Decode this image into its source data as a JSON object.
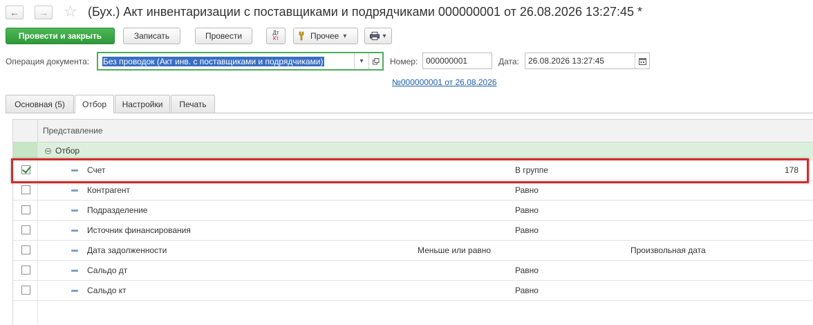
{
  "window": {
    "title": "(Бух.) Акт инвентаризации с поставщиками и подрядчиками 000000001 от 26.08.2026 13:27:45 *",
    "back_icon": "←",
    "forward_icon": "→",
    "star_icon": "☆"
  },
  "toolbar": {
    "post_close_label": "Провести и закрыть",
    "save_label": "Записать",
    "post_label": "Провести",
    "dtkt_top": "Дт",
    "dtkt_bottom": "Кт",
    "more_label": "Прочее",
    "dropdown_arrow": "▾"
  },
  "form": {
    "operation_label": "Операция документа:",
    "operation_value": "Без проводок (Акт инв. с поставщиками и подрядчиками)",
    "number_label": "Номер:",
    "number_value": "000000001",
    "date_label": "Дата:",
    "date_value": "26.08.2026 13:27:45",
    "doc_link": "№000000001 от 26.08.2026"
  },
  "tabs": [
    {
      "label": "Основная (5)"
    },
    {
      "label": "Отбор"
    },
    {
      "label": "Настройки"
    },
    {
      "label": "Печать"
    }
  ],
  "table": {
    "header": "Представление",
    "group_label": "Отбор",
    "rows": [
      {
        "name": "Счет",
        "condition": "В группе",
        "value": "178",
        "checked": true
      },
      {
        "name": "Контрагент",
        "condition": "Равно",
        "value": "",
        "checked": false
      },
      {
        "name": "Подразделение",
        "condition": "Равно",
        "value": "",
        "checked": false
      },
      {
        "name": "Источник финансирования",
        "condition": "Равно",
        "value": "",
        "checked": false
      },
      {
        "name": "Дата задолженности",
        "condition": "Меньше или равно",
        "value": "Произвольная дата",
        "checked": false
      },
      {
        "name": "Сальдо дт",
        "condition": "Равно",
        "value": "",
        "checked": false
      },
      {
        "name": "Сальдо кт",
        "condition": "Равно",
        "value": "",
        "checked": false
      }
    ]
  },
  "colors": {
    "accent_green": "#2e9a3a",
    "highlight_red": "#d42a2a",
    "group_bg": "#dcefdc",
    "link_blue": "#1f5fa8"
  }
}
